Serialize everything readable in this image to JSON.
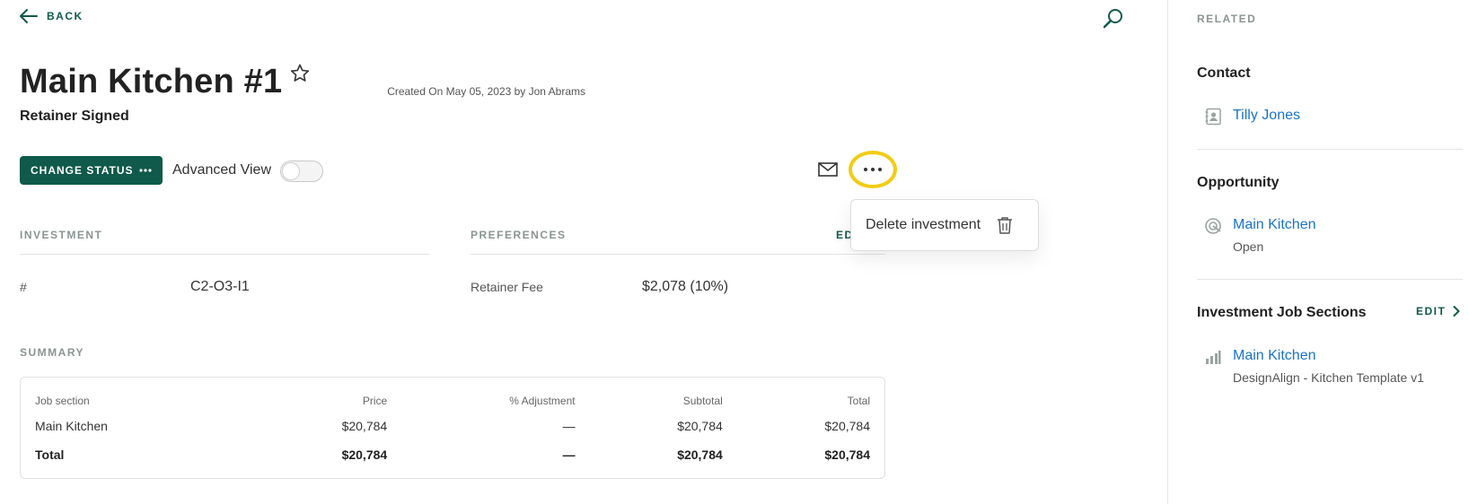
{
  "header": {
    "back_label": "BACK",
    "title": "Main Kitchen #1",
    "status": "Retainer Signed",
    "created": "Created On May 05, 2023 by Jon Abrams"
  },
  "actions": {
    "change_status_label": "CHANGE STATUS",
    "advanced_view_label": "Advanced View",
    "advanced_view_on": false
  },
  "menu": {
    "delete_label": "Delete investment"
  },
  "investment": {
    "heading": "INVESTMENT",
    "number_label": "#",
    "number_value": "C2-O3-I1"
  },
  "preferences": {
    "heading": "PREFERENCES",
    "edit_label": "ED",
    "retainer_label": "Retainer Fee",
    "retainer_value": "$2,078 (10%)"
  },
  "summary": {
    "heading": "SUMMARY",
    "columns": [
      "Job section",
      "Price",
      "% Adjustment",
      "Subtotal",
      "Total"
    ],
    "rows": [
      [
        "Main Kitchen",
        "$20,784",
        "—",
        "$20,784",
        "$20,784"
      ]
    ],
    "total_row": [
      "Total",
      "$20,784",
      "—",
      "$20,784",
      "$20,784"
    ]
  },
  "related": {
    "heading": "RELATED",
    "contact": {
      "title": "Contact",
      "name": "Tilly Jones"
    },
    "opportunity": {
      "title": "Opportunity",
      "name": "Main Kitchen",
      "status": "Open"
    },
    "job_sections": {
      "title": "Investment Job Sections",
      "edit_label": "EDIT",
      "name": "Main Kitchen",
      "template": "DesignAlign - Kitchen Template v1"
    }
  },
  "colors": {
    "brand": "#0f5a4a",
    "link": "#1a73c8",
    "highlight": "#f2cc13"
  },
  "icons": [
    "arrow-left-icon",
    "search-icon",
    "star-icon",
    "ellipsis-icon",
    "mail-icon",
    "trash-icon",
    "contact-book-icon",
    "opportunity-target-icon",
    "bar-chart-icon",
    "chevron-right-icon"
  ]
}
